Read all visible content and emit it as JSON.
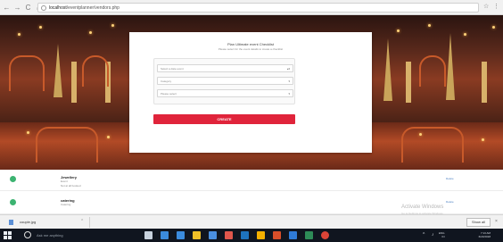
{
  "browser": {
    "url_host": "localhost",
    "url_path": "/eventplanner/vendors.php",
    "back_glyph": "←",
    "forward_glyph": "→",
    "reload_glyph": "C",
    "home_glyph": "⌂",
    "right_glyphs": [
      "☆",
      "⋮"
    ]
  },
  "modal": {
    "title": "Plan Ultimate event Checklist",
    "subtitle": "Please select for the event details to create a checklist",
    "fields": [
      {
        "placeholder": "Select a date event",
        "chevron": "▴▾"
      },
      {
        "placeholder": "Category",
        "chevron": "▾"
      },
      {
        "placeholder": "Please select",
        "chevron": "▾"
      }
    ],
    "create_label": "CREATE",
    "accent": "#e0243b"
  },
  "list": {
    "rows": [
      {
        "title": "Jewellery",
        "meta": [
          "Event",
          "Not at all booked"
        ],
        "action": "Delete",
        "status_color": "#3cb371"
      },
      {
        "title": "catering",
        "meta": [
          "Catering",
          ""
        ],
        "action": "Delete",
        "status_color": "#3cb371"
      }
    ]
  },
  "watermark": {
    "title": "Activate Windows",
    "subtitle": "Go to Settings to activate Windows."
  },
  "download_bar": {
    "file_name": "couple.jpg",
    "chevron": "⌃",
    "show_all": "Show all",
    "close": "×"
  },
  "taskbar": {
    "search_placeholder": "Ask me anything",
    "icon_colors": [
      "#c8d2de",
      "#3b8bdd",
      "#3b8bdd",
      "#f0c028",
      "#4a8fe0",
      "#e1574c",
      "#1e73be",
      "#f4b000",
      "#d94f2a",
      "#2f7bd8",
      "#2e8b57",
      "#db4437"
    ],
    "tray": {
      "language": "ENG",
      "region": "IN",
      "time": "7:13 AM",
      "date": "6/23/2018",
      "glyphs": [
        "^",
        "♪"
      ]
    }
  }
}
